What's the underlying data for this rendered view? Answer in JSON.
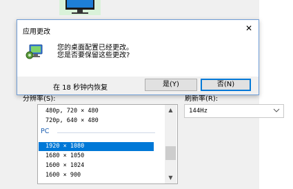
{
  "dialog": {
    "title": "应用更改",
    "close_glyph": "✕",
    "message_line1": "您的桌面配置已经更改。",
    "message_line2": "您是否要保留这些更改?",
    "countdown_text": "在 18 秒钟内恢复",
    "yes_label": "是(Y)",
    "no_label": "否(N)"
  },
  "background": {
    "resolution_label": "分辨率(S):",
    "refresh_label": "刷新率(R):",
    "refresh_value": "144Hz",
    "resolution_items_top": [
      "480p, 720 × 480",
      "720p, 640 × 480"
    ],
    "group_label": "PC",
    "resolution_items": [
      {
        "text": "1920 × 1080",
        "selected": true
      },
      {
        "text": "1680 × 1050",
        "selected": false
      },
      {
        "text": "1600 × 1024",
        "selected": false
      },
      {
        "text": "1600 × 900",
        "selected": false
      }
    ]
  },
  "colors": {
    "selection": "#0078d7",
    "dialog_border": "#6e9cd6",
    "group_label": "#1c5fb1"
  }
}
